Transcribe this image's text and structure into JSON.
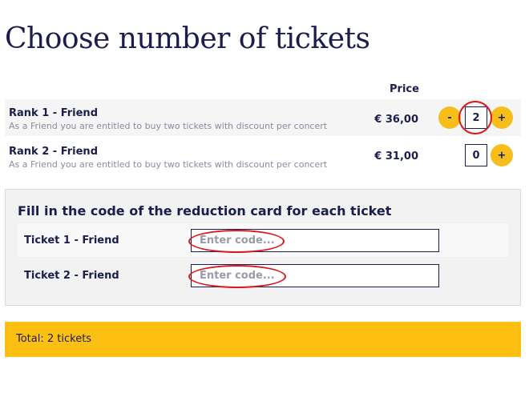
{
  "page": {
    "title": "Choose number of tickets",
    "price_header": "Price"
  },
  "ranks": [
    {
      "name": "Rank 1 - Friend",
      "description": "As a Friend you are entitled to buy two tickets with discount per concert",
      "price": "€ 36,00",
      "minus_label": "-",
      "quantity": "2",
      "plus_label": "+"
    },
    {
      "name": "Rank 2 - Friend",
      "description": "As a Friend you are entitled to buy two tickets with discount per concert",
      "price": "€ 31,00",
      "quantity": "0",
      "plus_label": "+"
    }
  ],
  "codes": {
    "title": "Fill in the code of the reduction card for each ticket",
    "tickets": [
      {
        "label": "Ticket 1 - Friend",
        "value": "",
        "placeholder": "Enter code..."
      },
      {
        "label": "Ticket 2 - Friend",
        "value": "",
        "placeholder": "Enter code..."
      }
    ]
  },
  "total": {
    "text": "Total: 2 tickets"
  },
  "colors": {
    "accent": "#f7bd1a",
    "total_bar": "#fcbf12",
    "text": "#1b1d4d",
    "annotation": "#d8191f"
  }
}
